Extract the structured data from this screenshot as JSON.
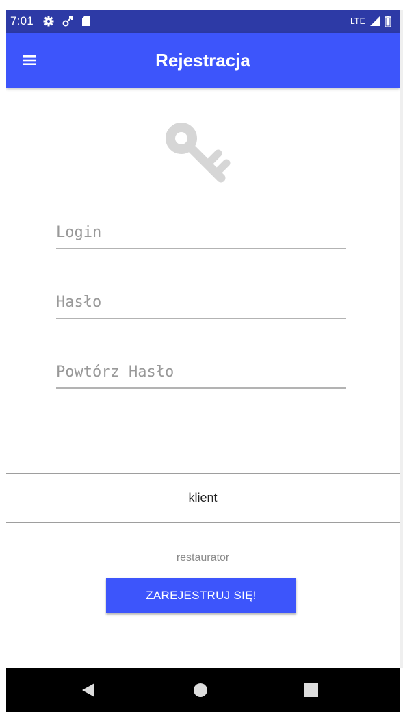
{
  "status_bar": {
    "time": "7:01",
    "network": "LTE",
    "icons": [
      "settings-icon",
      "signal-off-icon",
      "sd-card-icon",
      "cell-signal-icon",
      "battery-icon"
    ]
  },
  "app_bar": {
    "title": "Rejestracja",
    "menu_icon": "hamburger-menu-icon",
    "color": "#3d55fb"
  },
  "header_icon": "key-icon",
  "form": {
    "login_placeholder": "Login",
    "password_placeholder": "Hasło",
    "repeat_password_placeholder": "Powtórz Hasło"
  },
  "account_types": {
    "options": [
      "klient",
      "restaurator"
    ],
    "selected": "klient"
  },
  "register_button": {
    "label": "ZAREJESTRUJ SIĘ!"
  },
  "nav_bar": {
    "icons": [
      "back-icon",
      "home-icon",
      "recent-apps-icon"
    ]
  }
}
